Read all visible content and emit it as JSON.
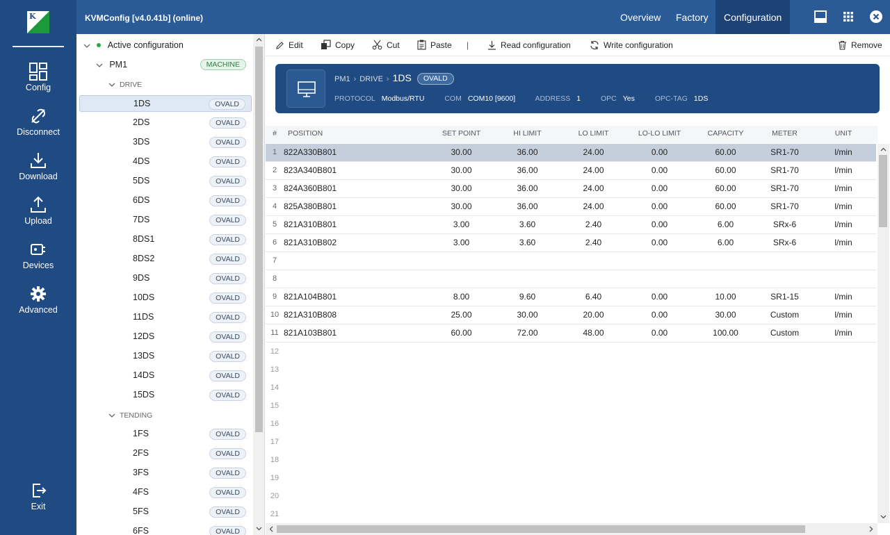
{
  "app": {
    "title": "KVMConfig [v4.0.41b] (online)"
  },
  "top_tabs": [
    {
      "label": "Overview"
    },
    {
      "label": "Factory"
    },
    {
      "label": "Configuration"
    }
  ],
  "rail": [
    {
      "label": "Config",
      "icon": "config-icon"
    },
    {
      "label": "Disconnect",
      "icon": "disconnect-icon"
    },
    {
      "label": "Download",
      "icon": "download-icon"
    },
    {
      "label": "Upload",
      "icon": "upload-icon"
    },
    {
      "label": "Devices",
      "icon": "devices-icon"
    },
    {
      "label": "Advanced",
      "icon": "gear-icon"
    },
    {
      "label": "Exit",
      "icon": "exit-icon"
    }
  ],
  "tree": {
    "root": "Active configuration",
    "machine": {
      "name": "PM1",
      "badge": "MACHINE"
    },
    "groups": [
      {
        "name": "DRIVE",
        "items": [
          "1DS",
          "2DS",
          "3DS",
          "4DS",
          "5DS",
          "6DS",
          "7DS",
          "8DS1",
          "8DS2",
          "9DS",
          "10DS",
          "11DS",
          "12DS",
          "13DS",
          "14DS",
          "15DS"
        ]
      },
      {
        "name": "TENDING",
        "items": [
          "1FS",
          "2FS",
          "3FS",
          "4FS",
          "5FS",
          "6FS"
        ]
      }
    ],
    "item_badge": "OVALD",
    "selected": "1DS"
  },
  "toolbar": {
    "edit": "Edit",
    "copy": "Copy",
    "cut": "Cut",
    "paste": "Paste",
    "divider": "|",
    "read": "Read configuration",
    "write": "Write configuration",
    "remove": "Remove"
  },
  "card": {
    "crumbs": [
      "PM1",
      "DRIVE"
    ],
    "current": "1DS",
    "badge": "OVALD",
    "props": [
      {
        "key": "PROTOCOL",
        "value": "Modbus/RTU"
      },
      {
        "key": "COM",
        "value": "COM10 [9600]"
      },
      {
        "key": "ADDRESS",
        "value": "1"
      },
      {
        "key": "OPC",
        "value": "Yes"
      },
      {
        "key": "OPC-TAG",
        "value": "1DS"
      }
    ]
  },
  "grid": {
    "columns": [
      "#",
      "POSITION",
      "SET POINT",
      "HI LIMIT",
      "LO LIMIT",
      "LO-LO LIMIT",
      "CAPACITY",
      "METER",
      "UNIT"
    ],
    "rows": [
      {
        "n": "1",
        "position": "822A330B801",
        "set_point": "30.00",
        "hi": "36.00",
        "lo": "24.00",
        "lolo": "0.00",
        "capacity": "60.00",
        "meter": "SR1-70",
        "unit": "l/min"
      },
      {
        "n": "2",
        "position": "823A340B801",
        "set_point": "30.00",
        "hi": "36.00",
        "lo": "24.00",
        "lolo": "0.00",
        "capacity": "60.00",
        "meter": "SR1-70",
        "unit": "l/min"
      },
      {
        "n": "3",
        "position": "824A360B801",
        "set_point": "30.00",
        "hi": "36.00",
        "lo": "24.00",
        "lolo": "0.00",
        "capacity": "60.00",
        "meter": "SR1-70",
        "unit": "l/min"
      },
      {
        "n": "4",
        "position": "825A380B801",
        "set_point": "30.00",
        "hi": "36.00",
        "lo": "24.00",
        "lolo": "0.00",
        "capacity": "60.00",
        "meter": "SR1-70",
        "unit": "l/min"
      },
      {
        "n": "5",
        "position": "821A310B801",
        "set_point": "3.00",
        "hi": "3.60",
        "lo": "2.40",
        "lolo": "0.00",
        "capacity": "6.00",
        "meter": "SRx-6",
        "unit": "l/min"
      },
      {
        "n": "6",
        "position": "821A310B802",
        "set_point": "3.00",
        "hi": "3.60",
        "lo": "2.40",
        "lolo": "0.00",
        "capacity": "6.00",
        "meter": "SRx-6",
        "unit": "l/min"
      },
      {
        "n": "7",
        "position": "",
        "set_point": "",
        "hi": "",
        "lo": "",
        "lolo": "",
        "capacity": "",
        "meter": "",
        "unit": ""
      },
      {
        "n": "8",
        "position": "",
        "set_point": "",
        "hi": "",
        "lo": "",
        "lolo": "",
        "capacity": "",
        "meter": "",
        "unit": ""
      },
      {
        "n": "9",
        "position": "821A104B801",
        "set_point": "8.00",
        "hi": "9.60",
        "lo": "6.40",
        "lolo": "0.00",
        "capacity": "10.00",
        "meter": "SR1-15",
        "unit": "l/min"
      },
      {
        "n": "10",
        "position": "821A310B808",
        "set_point": "25.00",
        "hi": "30.00",
        "lo": "20.00",
        "lolo": "0.00",
        "capacity": "30.00",
        "meter": "Custom",
        "unit": "l/min"
      },
      {
        "n": "11",
        "position": "821A103B801",
        "set_point": "60.00",
        "hi": "72.00",
        "lo": "48.00",
        "lolo": "0.00",
        "capacity": "100.00",
        "meter": "Custom",
        "unit": "l/min"
      }
    ],
    "empty_rows": [
      "12",
      "13",
      "14",
      "15",
      "16",
      "17",
      "18",
      "19",
      "20",
      "21"
    ]
  }
}
